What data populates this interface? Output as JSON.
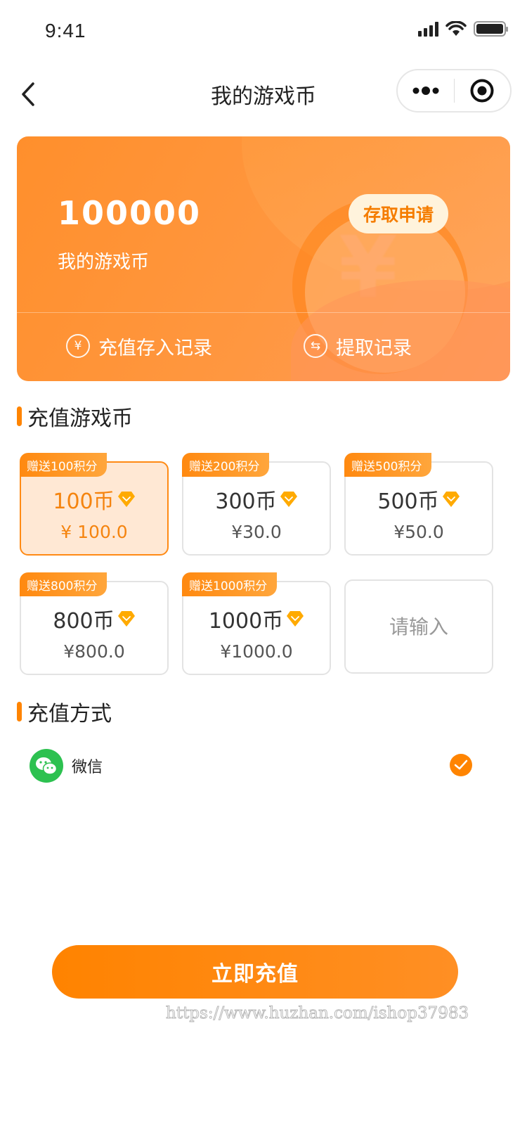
{
  "status_bar": {
    "time": "9:41"
  },
  "nav": {
    "title": "我的游戏币",
    "more_icon": "more-dots-icon",
    "close_icon": "target-circle-icon"
  },
  "coin_card": {
    "amount": "100000",
    "label": "我的游戏币",
    "apply_button": "存取申请",
    "deposit_records": "充值存入记录",
    "withdraw_records": "提取记录",
    "deposit_icon_glyph": "¥",
    "withdraw_icon_glyph": "⇆"
  },
  "recharge_section": {
    "title": "充值游戏币",
    "packages": [
      {
        "badge": "赠送100积分",
        "coins": "100币",
        "price": "¥ 100.0",
        "selected": true
      },
      {
        "badge": "赠送200积分",
        "coins": "300币",
        "price": "¥30.0",
        "selected": false
      },
      {
        "badge": "赠送500积分",
        "coins": "500币",
        "price": "¥50.0",
        "selected": false
      },
      {
        "badge": "赠送800积分",
        "coins": "800币",
        "price": "¥800.0",
        "selected": false
      },
      {
        "badge": "赠送1000积分",
        "coins": "1000币",
        "price": "¥1000.0",
        "selected": false
      }
    ],
    "custom_input_placeholder": "请输入"
  },
  "payment_section": {
    "title": "充值方式",
    "methods": [
      {
        "label": "微信",
        "icon": "wechat-icon",
        "checked": true
      }
    ]
  },
  "submit_button": "立即充值",
  "watermark": "https://www.huzhan.com/ishop37983",
  "colors": {
    "accent": "#ff8400",
    "selected_bg": "#ffe8d4",
    "apply_button_bg": "#fff3dc",
    "wechat_green": "#2dc150"
  }
}
